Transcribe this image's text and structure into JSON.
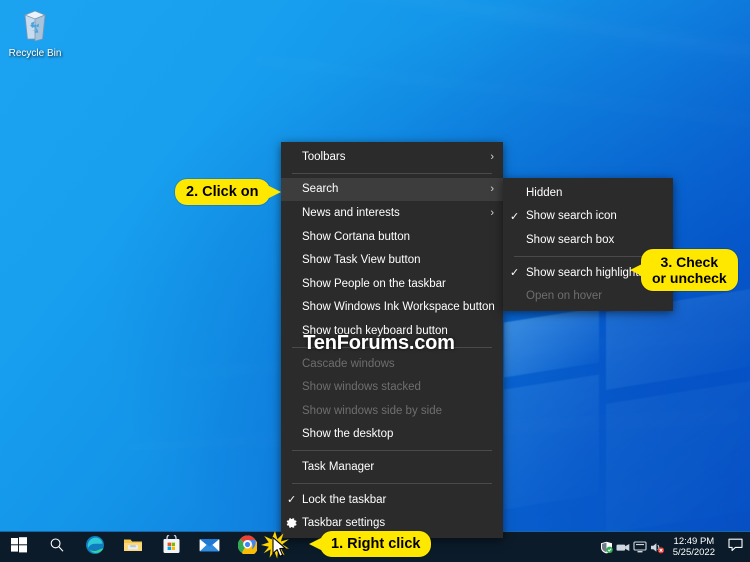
{
  "desktop": {
    "icons": [
      {
        "label": "Recycle Bin",
        "icon": "recycle-bin-icon"
      }
    ]
  },
  "taskbar": {
    "buttons": [
      {
        "name": "start-button",
        "icon": "windows-logo-icon"
      },
      {
        "name": "search-button",
        "icon": "search-magnifier-icon"
      },
      {
        "name": "edge-button",
        "icon": "microsoft-edge-icon"
      },
      {
        "name": "file-explorer-button",
        "icon": "file-explorer-folder-icon"
      },
      {
        "name": "microsoft-store-button",
        "icon": "microsoft-store-icon"
      },
      {
        "name": "mail-button",
        "icon": "mail-envelope-icon"
      },
      {
        "name": "chrome-button",
        "icon": "google-chrome-icon"
      }
    ],
    "tray": [
      {
        "name": "security-shield-icon",
        "icon": "windows-security-shield-icon"
      },
      {
        "name": "removable-device-icon",
        "icon": "safely-remove-hardware-icon"
      },
      {
        "name": "network-icon",
        "icon": "network-monitor-icon"
      },
      {
        "name": "volume-icon",
        "icon": "volume-muted-icon"
      }
    ],
    "clock": {
      "time": "12:49 PM",
      "date": "5/25/2022"
    },
    "action_center": {
      "icon": "action-center-speech-bubble-icon"
    }
  },
  "context_menu": {
    "items": [
      {
        "label": "Toolbars",
        "submenu": true,
        "checked": false,
        "disabled": false,
        "highlighted": false,
        "separator_after": true
      },
      {
        "label": "Search",
        "submenu": true,
        "checked": false,
        "disabled": false,
        "highlighted": true,
        "separator_after": false
      },
      {
        "label": "News and interests",
        "submenu": true,
        "checked": false,
        "disabled": false,
        "highlighted": false,
        "separator_after": false
      },
      {
        "label": "Show Cortana button",
        "submenu": false,
        "checked": false,
        "disabled": false,
        "highlighted": false,
        "separator_after": false
      },
      {
        "label": "Show Task View button",
        "submenu": false,
        "checked": false,
        "disabled": false,
        "highlighted": false,
        "separator_after": false
      },
      {
        "label": "Show People on the taskbar",
        "submenu": false,
        "checked": false,
        "disabled": false,
        "highlighted": false,
        "separator_after": false
      },
      {
        "label": "Show Windows Ink Workspace button",
        "submenu": false,
        "checked": false,
        "disabled": false,
        "highlighted": false,
        "separator_after": false
      },
      {
        "label": "Show touch keyboard button",
        "submenu": false,
        "checked": false,
        "disabled": false,
        "highlighted": false,
        "separator_after": true
      },
      {
        "label": "Cascade windows",
        "submenu": false,
        "checked": false,
        "disabled": true,
        "highlighted": false,
        "separator_after": false
      },
      {
        "label": "Show windows stacked",
        "submenu": false,
        "checked": false,
        "disabled": true,
        "highlighted": false,
        "separator_after": false
      },
      {
        "label": "Show windows side by side",
        "submenu": false,
        "checked": false,
        "disabled": true,
        "highlighted": false,
        "separator_after": false
      },
      {
        "label": "Show the desktop",
        "submenu": false,
        "checked": false,
        "disabled": false,
        "highlighted": false,
        "separator_after": true
      },
      {
        "label": "Task Manager",
        "submenu": false,
        "checked": false,
        "disabled": false,
        "highlighted": false,
        "separator_after": true
      },
      {
        "label": "Lock the taskbar",
        "submenu": false,
        "checked": true,
        "disabled": false,
        "highlighted": false,
        "separator_after": false
      },
      {
        "label": "Taskbar settings",
        "submenu": false,
        "checked": false,
        "disabled": false,
        "highlighted": false,
        "separator_after": false,
        "icon": "gear-icon"
      }
    ]
  },
  "search_submenu": {
    "items": [
      {
        "label": "Hidden",
        "checked": false,
        "disabled": false,
        "separator_after": false
      },
      {
        "label": "Show search icon",
        "checked": true,
        "disabled": false,
        "separator_after": false
      },
      {
        "label": "Show search box",
        "checked": false,
        "disabled": false,
        "separator_after": true
      },
      {
        "label": "Show search highlights",
        "checked": true,
        "disabled": false,
        "separator_after": false
      },
      {
        "label": "Open on hover",
        "checked": false,
        "disabled": true,
        "separator_after": false
      }
    ]
  },
  "callouts": {
    "step1": "1. Right click",
    "step2": "2. Click on",
    "step3_line1": "3. Check",
    "step3_line2": "or uncheck"
  },
  "watermark": "TenForums.com",
  "colors": {
    "callout_yellow": "#ffe800",
    "menu_background": "#2b2b2b",
    "menu_highlight": "#3d3d3d",
    "taskbar": "#0b1b29",
    "desktop_accent": "#1ca3f0"
  }
}
